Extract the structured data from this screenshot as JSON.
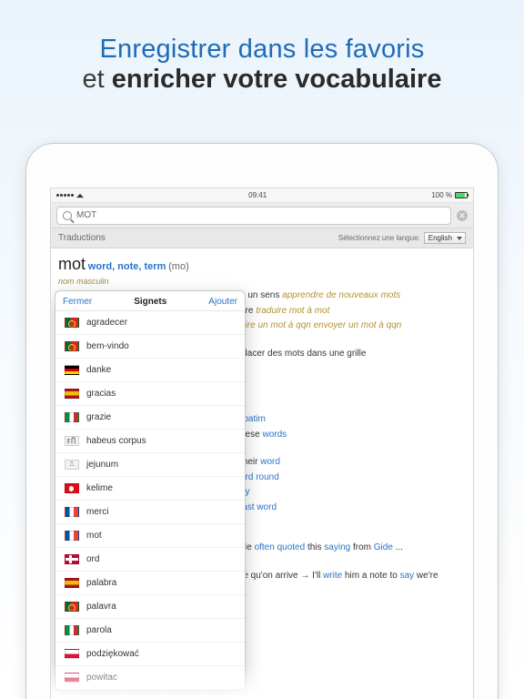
{
  "promo": {
    "line1": "Enregistrer dans les favoris",
    "line2_prefix": "et ",
    "line2_bold": "enricher votre vocabulaire"
  },
  "statusbar": {
    "time": "09:41",
    "battery": "100 %"
  },
  "search": {
    "value": "MOT"
  },
  "subheader": {
    "title": "Traductions",
    "select_label": "Sélectionnez une langue:",
    "language": "English"
  },
  "entry": {
    "headword": "mot",
    "senses": "word, note, term",
    "pron": "(mo)",
    "pos": "nom masculin",
    "ex1_tail_plain": "a un sens ",
    "ex1_tail_it": "apprendre de nouveaux mots",
    "ex2_tail_plain": "dre ",
    "ex2_tail_it": "traduire mot à mot",
    "ex3_tail_it": "dire un mot à qqn envoyer un mot à qqn",
    "ex4": "placer des mots dans une grille",
    "r1_tail": "rbatim",
    "r2_a": "nese ",
    "r2_b": "words",
    "r3_a": "their ",
    "r3_b": "word",
    "r4_a": "ord round",
    "r5_a": "ay",
    "r6_a": "last word",
    "q_a": "re qu'on arrive → I'll ",
    "q_b": "write",
    "q_c": " him a note to ",
    "q_d": "say",
    "q_e": " we're",
    "cite_a": "He ",
    "cite_b": "often quoted",
    "cite_c": " this ",
    "cite_d": "saying",
    "cite_e": " from ",
    "cite_f": "Gide",
    "cite_g": " ..."
  },
  "popover": {
    "close": "Fermer",
    "title": "Signets",
    "add": "Ajouter",
    "items": [
      {
        "flag": "pt",
        "label": "agradecer"
      },
      {
        "flag": "pt",
        "label": "bem-vindo"
      },
      {
        "flag": "de",
        "label": "danke"
      },
      {
        "flag": "es",
        "label": "gracias"
      },
      {
        "flag": "it",
        "label": "grazie"
      },
      {
        "flag": "la",
        "label": "habeus corpus"
      },
      {
        "flag": "med",
        "label": "jejunum"
      },
      {
        "flag": "tr",
        "label": "kelime"
      },
      {
        "flag": "fr",
        "label": "merci"
      },
      {
        "flag": "fr",
        "label": "mot"
      },
      {
        "flag": "no",
        "label": "ord"
      },
      {
        "flag": "es",
        "label": "palabra"
      },
      {
        "flag": "pt",
        "label": "palavra"
      },
      {
        "flag": "it",
        "label": "parola"
      },
      {
        "flag": "pl",
        "label": "podziękować"
      },
      {
        "flag": "pl",
        "label": "powitac"
      }
    ]
  }
}
